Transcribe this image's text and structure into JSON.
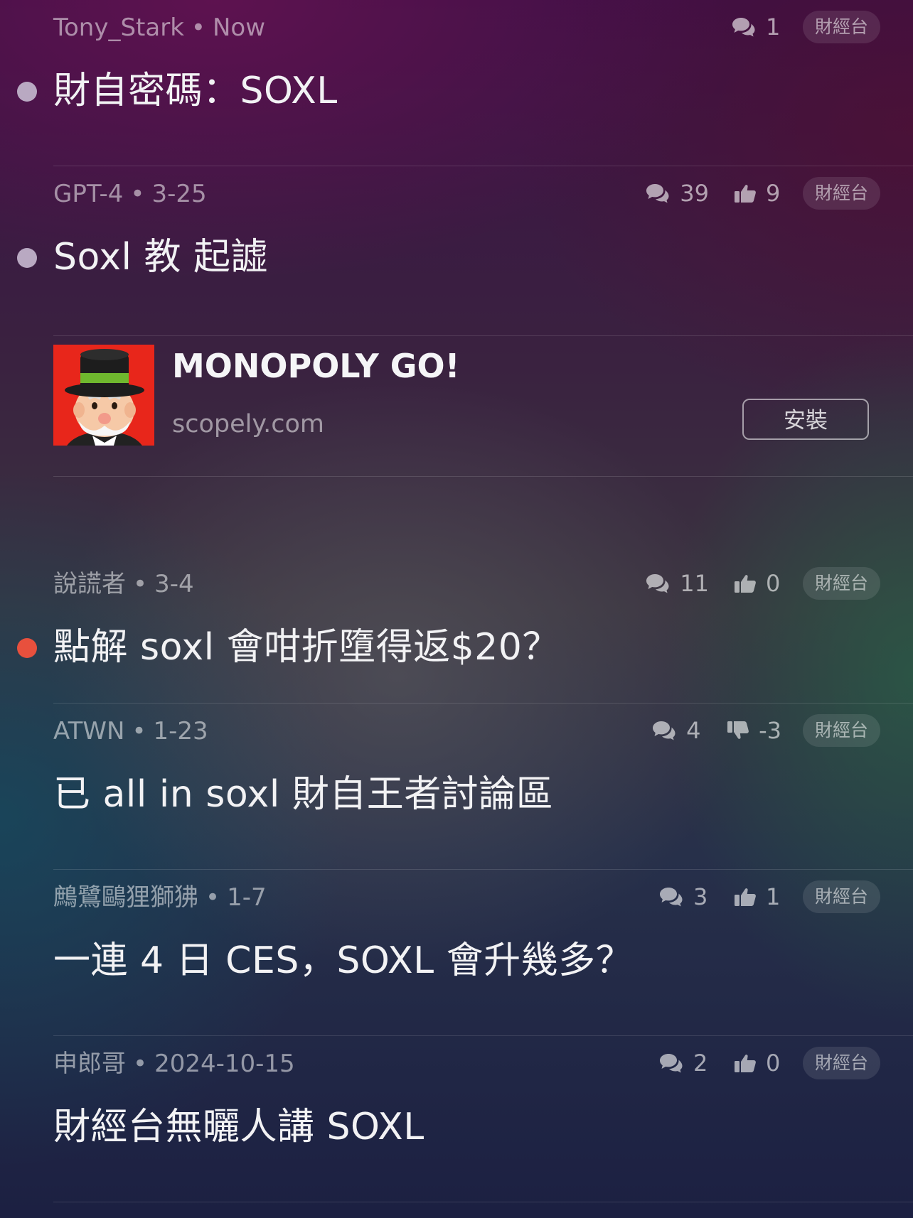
{
  "posts": [
    {
      "author": "Tony_Stark",
      "date": "Now",
      "comments": "1",
      "likes": "",
      "like_type": "none",
      "tag": "財經台",
      "title": "財自密碼：SOXL",
      "dot_color": "#b9a9c2"
    },
    {
      "author": "GPT-4",
      "date": "3-25",
      "comments": "39",
      "likes": "9",
      "like_type": "up",
      "tag": "財經台",
      "title": "Soxl 教 起譃",
      "dot_color": "#b9a9c2"
    },
    {
      "author": "說謊者",
      "date": "3-4",
      "comments": "11",
      "likes": "0",
      "like_type": "up",
      "tag": "財經台",
      "title": "點解 soxl 會咁折墮得返$20？",
      "dot_color": "#e8503d"
    },
    {
      "author": "ATWN",
      "date": "1-23",
      "comments": "4",
      "likes": "-3",
      "like_type": "down",
      "tag": "財經台",
      "title": "已 all in soxl 財自王者討論區",
      "dot_color": ""
    },
    {
      "author": "鷓鷺鷗狸獅狒",
      "date": "1-7",
      "comments": "3",
      "likes": "1",
      "like_type": "up",
      "tag": "財經台",
      "title": "一連 4 日 CES，SOXL 會升幾多？",
      "dot_color": ""
    },
    {
      "author": "申郎哥",
      "date": "2024-10-15",
      "comments": "2",
      "likes": "0",
      "like_type": "up",
      "tag": "財經台",
      "title": "財經台無曬人講 SOXL",
      "dot_color": ""
    }
  ],
  "ad": {
    "name": "MONOPOLY GO!",
    "domain": "scopely.com",
    "button": "安裝"
  },
  "separator": "•"
}
